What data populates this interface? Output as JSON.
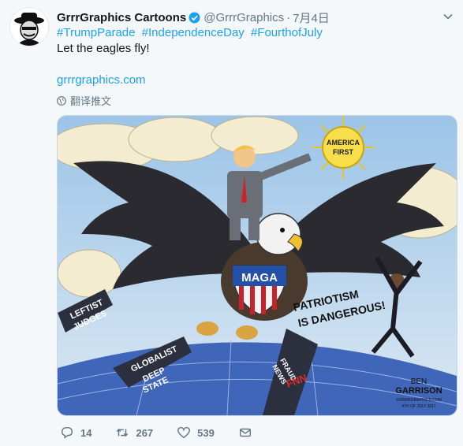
{
  "tweet": {
    "display_name": "GrrrGraphics Cartoons",
    "handle": "@GrrrGraphics",
    "date": "7月4日",
    "hashtags": [
      "#TrumpParade",
      "#IndependenceDay",
      "#FourthofJuly"
    ],
    "text": "Let the eagles fly!",
    "link": "grrrgraphics.com",
    "translate_label": "翻译推文"
  },
  "cartoon": {
    "sun_text_1": "AMERICA",
    "sun_text_2": "FIRST",
    "shield_text": "MAGA",
    "judges_1": "LEFTIST",
    "judges_2": "JUDGES",
    "state_1": "GLOBALIST",
    "state_2": "DEEP",
    "state_3": "STATE",
    "news_1": "FRAUD",
    "news_2": "NEWS",
    "news_3": "FNN",
    "slogan_1": "PATRIOTISM",
    "slogan_2": "IS DANGEROUS!",
    "sig_1": "BEN",
    "sig_2": "GARRISON",
    "sig_3": "©GRRRGRAPHICS.COM",
    "sig_4": "4TH OF JULY 2017"
  },
  "actions": {
    "replies": "14",
    "retweets": "267",
    "likes": "539"
  },
  "colors": {
    "link": "#1da1f2",
    "muted": "#657786",
    "verified": "#1da1f2"
  }
}
